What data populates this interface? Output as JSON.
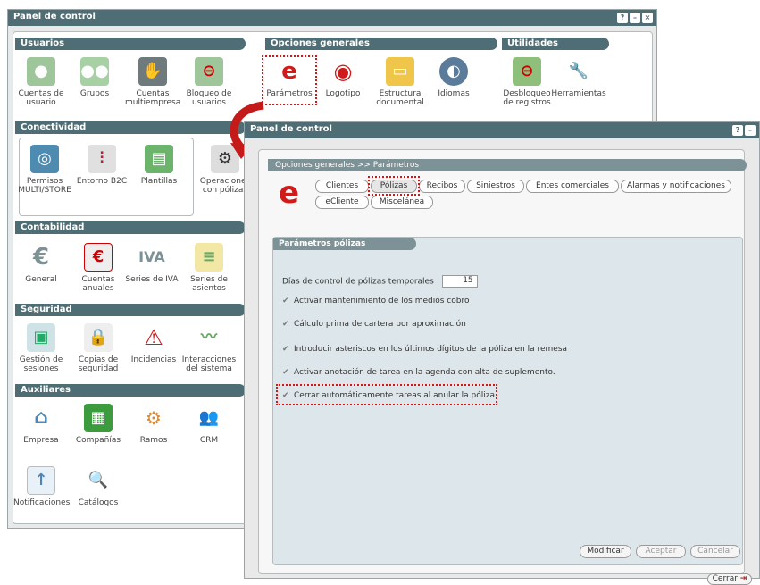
{
  "win1": {
    "title": "Panel de control"
  },
  "usuarios": {
    "header": "Usuarios",
    "items": [
      "Cuentas de usuario",
      "Grupos",
      "Cuentas multiempresa",
      "Bloqueo de usuarios"
    ]
  },
  "opciones": {
    "header": "Opciones generales",
    "items": [
      "Parámetros",
      "Logotipo",
      "Estructura documental",
      "Idiomas"
    ]
  },
  "utilidades": {
    "header": "Utilidades",
    "items": [
      "Desbloqueo de registros",
      "Herramientas"
    ]
  },
  "conectividad": {
    "header": "Conectividad",
    "items": [
      "Permisos MULTI/STORE",
      "Entorno B2C",
      "Plantillas",
      "Operaciones con pólizas"
    ]
  },
  "contabilidad": {
    "header": "Contabilidad",
    "items": [
      "General",
      "Cuentas anuales",
      "Series de IVA",
      "Series de asientos"
    ],
    "iva_glyph": "IVA",
    "euro_glyph": "€"
  },
  "seguridad": {
    "header": "Seguridad",
    "items": [
      "Gestión de sesiones",
      "Copias de seguridad",
      "Incidencias",
      "Interacciones del sistema"
    ]
  },
  "auxiliares": {
    "header": "Auxiliares",
    "items": [
      "Empresa",
      "Compañías",
      "Ramos",
      "CRM",
      "Notificaciones",
      "Catálogos"
    ]
  },
  "win2": {
    "title": "Panel de control",
    "breadcrumb": "Opciones generales >> Parámetros",
    "tabs_row1": [
      "Clientes",
      "Pólizas",
      "Recibos",
      "Siniestros",
      "Entes comerciales",
      "Alarmas y notificaciones"
    ],
    "tabs_row2": [
      "eCliente",
      "Miscelánea"
    ],
    "subpanel_title": "Parámetros pólizas",
    "dias_label": "Días de control de pólizas temporales",
    "dias_value": "15",
    "options": [
      "Activar mantenimiento de los medios cobro",
      "Cálculo prima de cartera por aproximación",
      "Introducir asteriscos en los últimos dígitos de la póliza en la remesa",
      "Activar anotación de tarea en la agenda con alta de suplemento.",
      "Cerrar automáticamente tareas al anular la póliza"
    ],
    "buttons": {
      "modificar": "Modificar",
      "aceptar": "Aceptar",
      "cancelar": "Cancelar"
    },
    "cerrar": "Cerrar",
    "e_logo": "e"
  },
  "titlebar_icons": [
    "?",
    "–",
    "×"
  ],
  "colors": {
    "header": "#4f6d74",
    "accent_red": "#d11a1a"
  }
}
